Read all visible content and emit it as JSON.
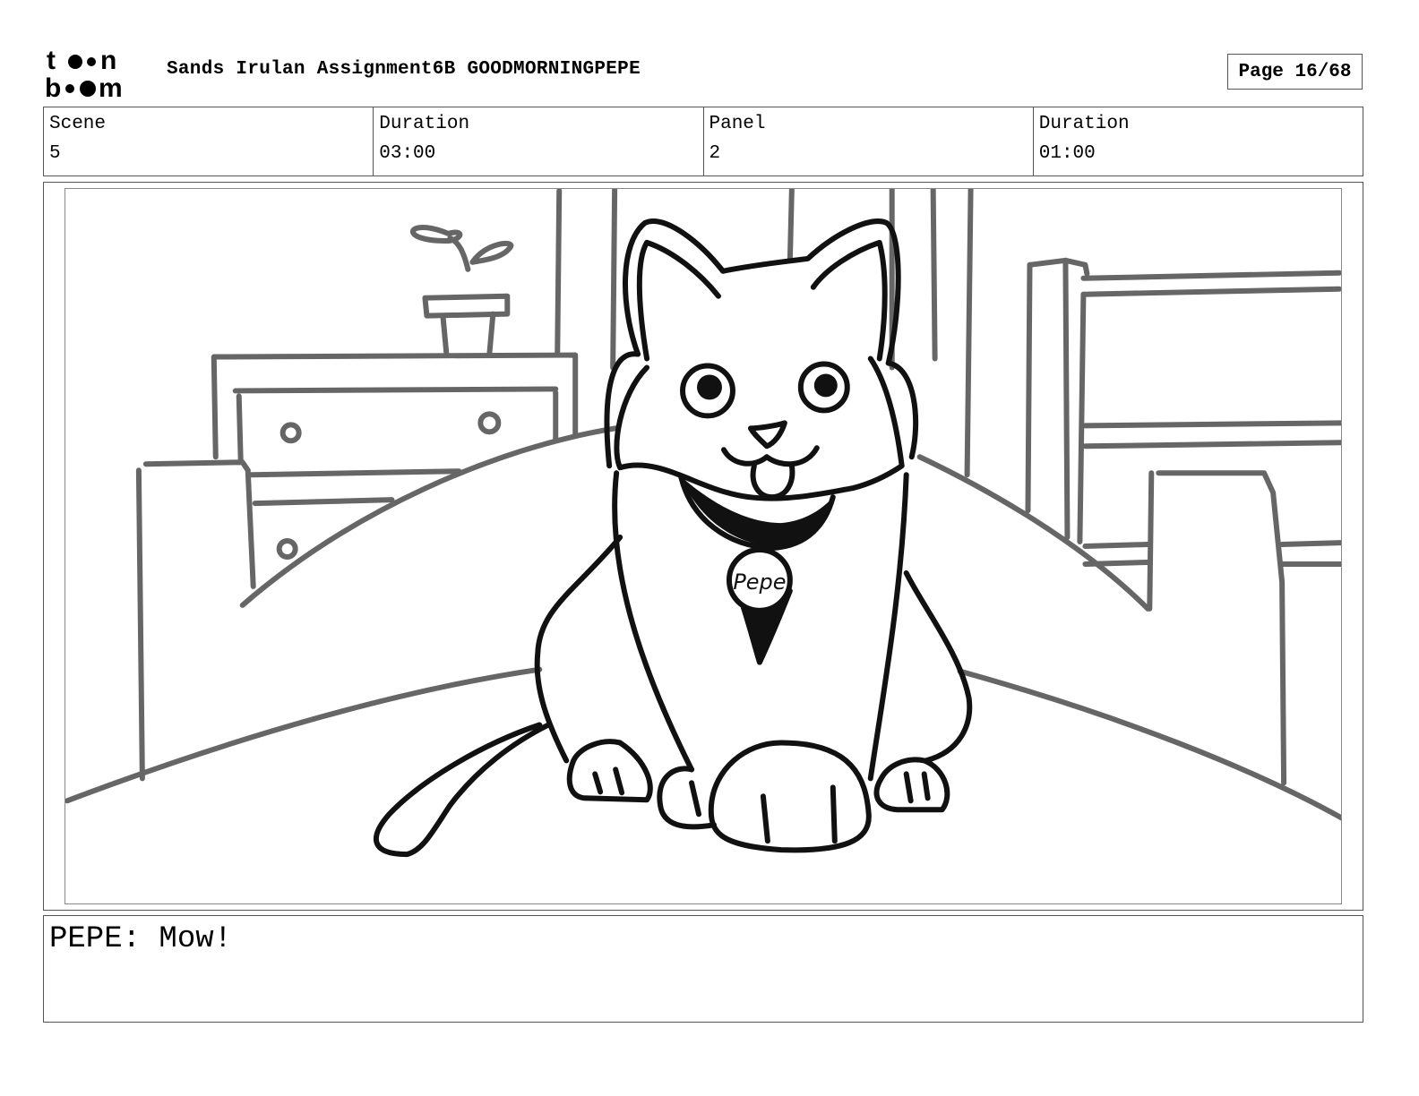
{
  "header": {
    "logo_text_top": "toon",
    "logo_text_bottom": "boom",
    "document_title": "Sands Irulan Assignment6B GOODMORNINGPEPE",
    "page_label": "Page 16/68"
  },
  "info_table": {
    "cells": [
      {
        "label": "Scene",
        "value": "5"
      },
      {
        "label": "Duration",
        "value": "03:00"
      },
      {
        "label": "Panel",
        "value": "2"
      },
      {
        "label": "Duration",
        "value": "01:00"
      }
    ]
  },
  "panel": {
    "collar_tag_text": "Pepe"
  },
  "dialogue": {
    "text": "PEPE: Mow!"
  }
}
